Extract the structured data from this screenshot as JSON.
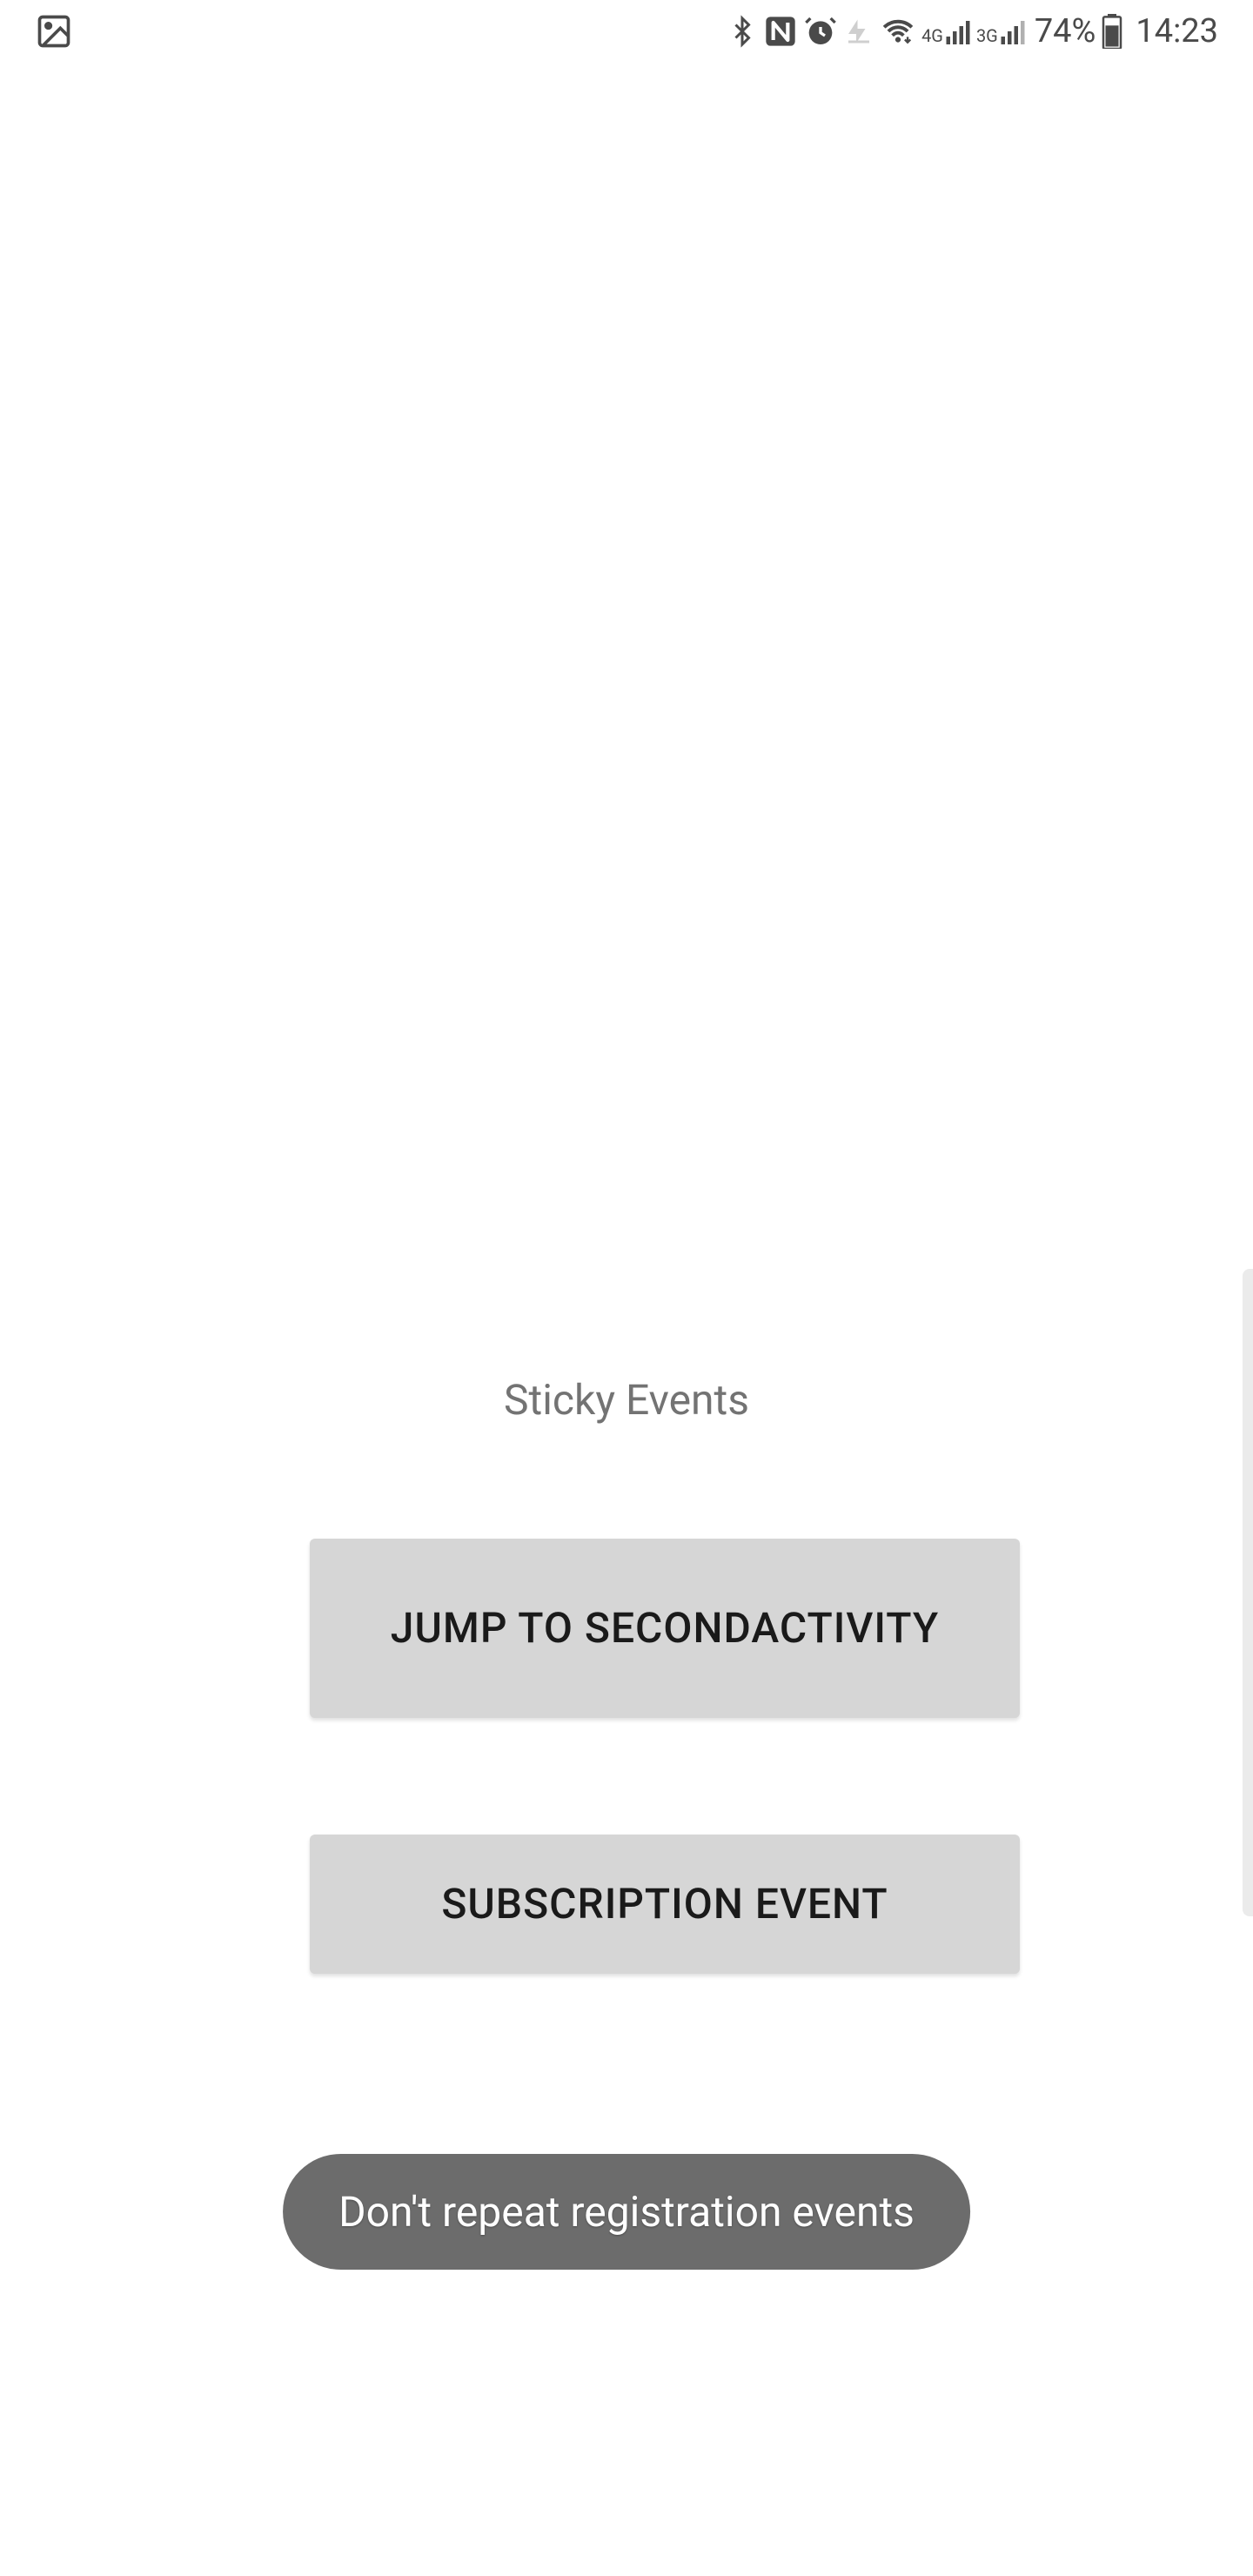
{
  "statusBar": {
    "batteryPercent": "74%",
    "time": "14:23",
    "signal4g": "4G",
    "signal3g": "3G"
  },
  "main": {
    "title": "Sticky Events",
    "jumpButton": "JUMP TO SECONDACTIVITY",
    "subscriptionButton": "SUBSCRIPTION EVENT"
  },
  "toast": {
    "message": "Don't repeat registration events"
  }
}
